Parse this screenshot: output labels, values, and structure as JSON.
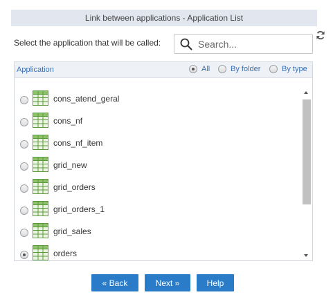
{
  "dialog": {
    "title": "Link between applications - Application List"
  },
  "prompt": {
    "label": "Select the application that will be called:"
  },
  "search": {
    "placeholder": "Search..."
  },
  "list": {
    "column_title": "Application",
    "filters": [
      {
        "label": "All",
        "checked": true
      },
      {
        "label": "By folder",
        "checked": false
      },
      {
        "label": "By type",
        "checked": false
      }
    ],
    "items": [
      {
        "name": "cons_atend_geral",
        "selected": false
      },
      {
        "name": "cons_nf",
        "selected": false
      },
      {
        "name": "cons_nf_item",
        "selected": false
      },
      {
        "name": "grid_new",
        "selected": false
      },
      {
        "name": "grid_orders",
        "selected": false
      },
      {
        "name": "grid_orders_1",
        "selected": false
      },
      {
        "name": "grid_sales",
        "selected": false
      },
      {
        "name": "orders",
        "selected": true
      }
    ]
  },
  "buttons": {
    "back": "« Back",
    "next": "Next »",
    "help": "Help"
  },
  "colors": {
    "accent": "#2b7cc8",
    "header_text": "#3b6fb0",
    "title_bg": "#e2e7ef",
    "icon_green": "#5a9a3a"
  }
}
